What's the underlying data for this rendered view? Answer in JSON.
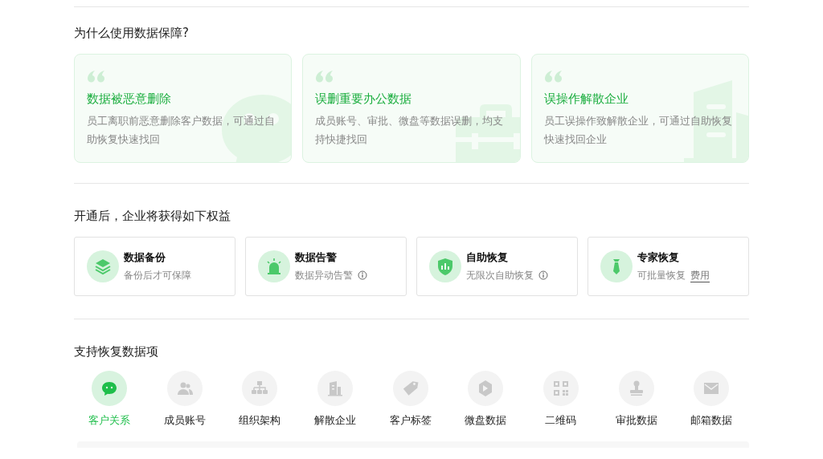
{
  "reasons": {
    "title": "为什么使用数据保障?",
    "cards": [
      {
        "title": "数据被恶意删除",
        "text": "员工离职前恶意删除客户数据，可通过自助恢复快速找回"
      },
      {
        "title": "误删重要办公数据",
        "text": "成员账号、审批、微盘等数据误删，均支持快捷找回"
      },
      {
        "title": "误操作解散企业",
        "text": "员工误操作致解散企业，可通过自助恢复快速找回企业"
      }
    ]
  },
  "benefits": {
    "title": "开通后，企业将获得如下权益",
    "items": [
      {
        "title": "数据备份",
        "text": "备份后才可保障",
        "info": false
      },
      {
        "title": "数据告警",
        "text": "数据异动告警",
        "info": true
      },
      {
        "title": "自助恢复",
        "text": "无限次自助恢复",
        "info": true
      },
      {
        "title": "专家恢复",
        "text": "可批量恢复",
        "info": false,
        "link": "费用"
      }
    ]
  },
  "recovery": {
    "title": "支持恢复数据项",
    "items": [
      {
        "label": "客户关系",
        "selected": true
      },
      {
        "label": "成员账号",
        "selected": false
      },
      {
        "label": "组织架构",
        "selected": false
      },
      {
        "label": "解散企业",
        "selected": false
      },
      {
        "label": "客户标签",
        "selected": false
      },
      {
        "label": "微盘数据",
        "selected": false
      },
      {
        "label": "二维码",
        "selected": false
      },
      {
        "label": "审批数据",
        "selected": false
      },
      {
        "label": "邮箱数据",
        "selected": false
      }
    ]
  }
}
